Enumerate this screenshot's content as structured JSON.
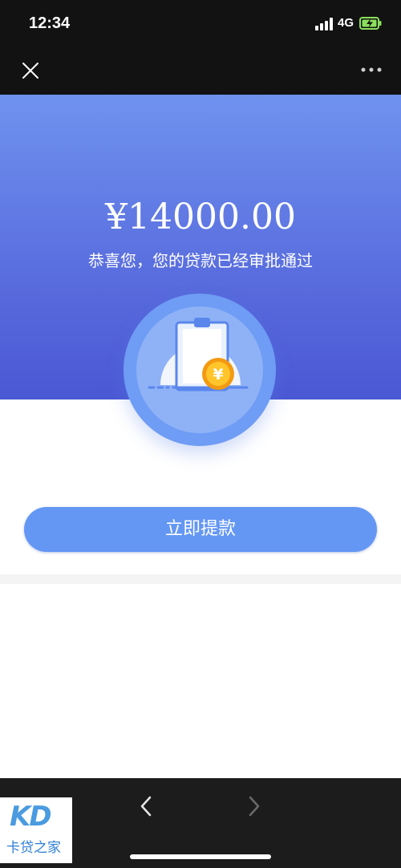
{
  "status_bar": {
    "time": "12:34",
    "network": "4G"
  },
  "hero": {
    "amount": "¥14000.00",
    "message": "恭喜您，您的贷款已经审批通过"
  },
  "actions": {
    "withdraw_label": "立即提款"
  },
  "watermark": {
    "logo": "KD",
    "name": "卡贷之家"
  },
  "icons": {
    "close": "close-icon",
    "more": "more-icon",
    "back": "chevron-left-icon",
    "forward": "chevron-right-icon"
  },
  "colors": {
    "hero_top": "#7fa9f6",
    "hero_bottom": "#3f4bcc",
    "button": "#6497f4",
    "coin": "#f6a21c"
  }
}
